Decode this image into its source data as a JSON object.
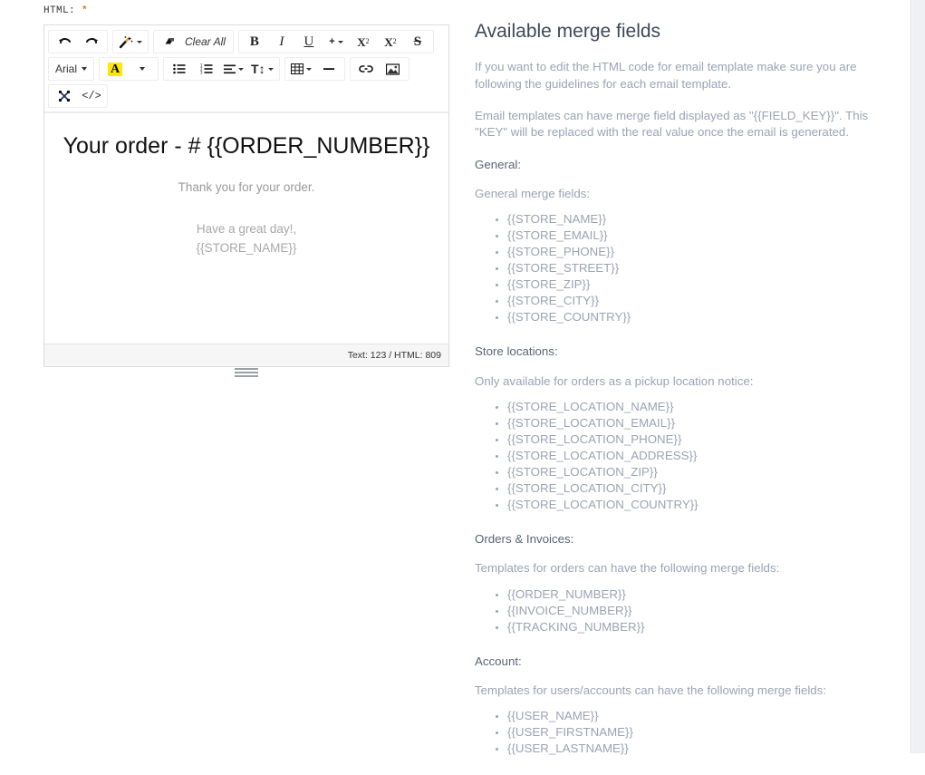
{
  "form": {
    "label": "HTML:",
    "required_marker": "*"
  },
  "editor": {
    "toolbar": {
      "row1": [
        {
          "group": "history",
          "buttons": [
            {
              "name": "undo-icon",
              "glyph": "↶"
            },
            {
              "name": "redo-icon",
              "glyph": "↷"
            }
          ]
        },
        {
          "group": "magic",
          "buttons": [
            {
              "name": "magic-wand-icon",
              "glyph": "✦",
              "has_caret": true
            }
          ]
        },
        {
          "group": "clear",
          "buttons": [
            {
              "name": "eraser-icon",
              "glyph": "◧"
            },
            {
              "name": "clear-all-button",
              "label": "Clear All"
            }
          ]
        },
        {
          "group": "format",
          "buttons": [
            {
              "name": "bold-button",
              "label": "B"
            },
            {
              "name": "italic-button",
              "label": "I"
            },
            {
              "name": "underline-button",
              "label": "U"
            },
            {
              "name": "more-format-button",
              "label": "+",
              "has_caret": true
            },
            {
              "name": "superscript-button",
              "label": "X",
              "script": "2",
              "position": "sup"
            },
            {
              "name": "subscript-button",
              "label": "X",
              "script": "2",
              "position": "sub"
            },
            {
              "name": "strikethrough-button",
              "label": "S"
            }
          ]
        }
      ],
      "row2": [
        {
          "group": "font-family",
          "buttons": [
            {
              "name": "font-family-select",
              "label": "Arial",
              "has_caret": true
            }
          ]
        },
        {
          "group": "font-color",
          "buttons": [
            {
              "name": "font-color-button",
              "label": "A",
              "has_caret": true
            }
          ]
        },
        {
          "group": "paragraph",
          "buttons": [
            {
              "name": "unordered-list-button",
              "glyph": "☰"
            },
            {
              "name": "ordered-list-button",
              "glyph": "☰"
            },
            {
              "name": "align-button",
              "glyph": "≡",
              "has_caret": true
            },
            {
              "name": "line-height-button",
              "label": "T↕",
              "has_caret": true
            }
          ]
        },
        {
          "group": "insert",
          "buttons": [
            {
              "name": "insert-table-button",
              "glyph": "▦",
              "has_caret": true
            },
            {
              "name": "horizontal-rule-button",
              "glyph": "—"
            }
          ]
        },
        {
          "group": "media",
          "buttons": [
            {
              "name": "insert-link-button",
              "glyph": "ὑ7"
            },
            {
              "name": "insert-image-button",
              "glyph": "ὛC"
            }
          ]
        }
      ],
      "row3": [
        {
          "group": "view",
          "buttons": [
            {
              "name": "fullscreen-icon",
              "glyph": "⤢"
            },
            {
              "name": "code-view-button",
              "label": "</>"
            }
          ]
        }
      ]
    },
    "content": {
      "heading_line1": "Your order - #",
      "heading_line2": "{{ORDER_NUMBER}}",
      "paragraph": "Thank you for your order.",
      "signoff_line1": "Have a great day!,",
      "signoff_line2": "{{STORE_NAME}}"
    },
    "status": "Text: 123 / HTML: 809"
  },
  "panel": {
    "title": "Available merge fields",
    "intro1": "If you want to edit the HTML code for email template make sure you are following the guidelines for each email template.",
    "intro2": "Email templates can have merge field displayed as \"{{FIELD_KEY}}\". This \"KEY\" will be replaced with the real value once the email is generated.",
    "sections": [
      {
        "heading": "General:",
        "note": "General merge fields:",
        "fields": [
          "{{STORE_NAME}}",
          "{{STORE_EMAIL}}",
          "{{STORE_PHONE}}",
          "{{STORE_STREET}}",
          "{{STORE_ZIP}}",
          "{{STORE_CITY}}",
          "{{STORE_COUNTRY}}"
        ]
      },
      {
        "heading": "Store locations:",
        "note": "Only available for orders as a pickup location notice:",
        "fields": [
          "{{STORE_LOCATION_NAME}}",
          "{{STORE_LOCATION_EMAIL}}",
          "{{STORE_LOCATION_PHONE}}",
          "{{STORE_LOCATION_ADDRESS}}",
          "{{STORE_LOCATION_ZIP}}",
          "{{STORE_LOCATION_CITY}}",
          "{{STORE_LOCATION_COUNTRY}}"
        ]
      },
      {
        "heading": "Orders & Invoices:",
        "note": "Templates for orders can have the following merge fields:",
        "fields": [
          "{{ORDER_NUMBER}}",
          "{{INVOICE_NUMBER}}",
          "{{TRACKING_NUMBER}}"
        ]
      },
      {
        "heading": "Account:",
        "note": "Templates for users/accounts can have the following merge fields:",
        "fields": [
          "{{USER_NAME}}",
          "{{USER_FIRSTNAME}}",
          "{{USER_LASTNAME}}"
        ]
      }
    ]
  },
  "colors": {
    "accent": "#ffe800",
    "required": "#c0861f",
    "panel_text": "#9ba3b4",
    "panel_heading": "#3c4858"
  }
}
